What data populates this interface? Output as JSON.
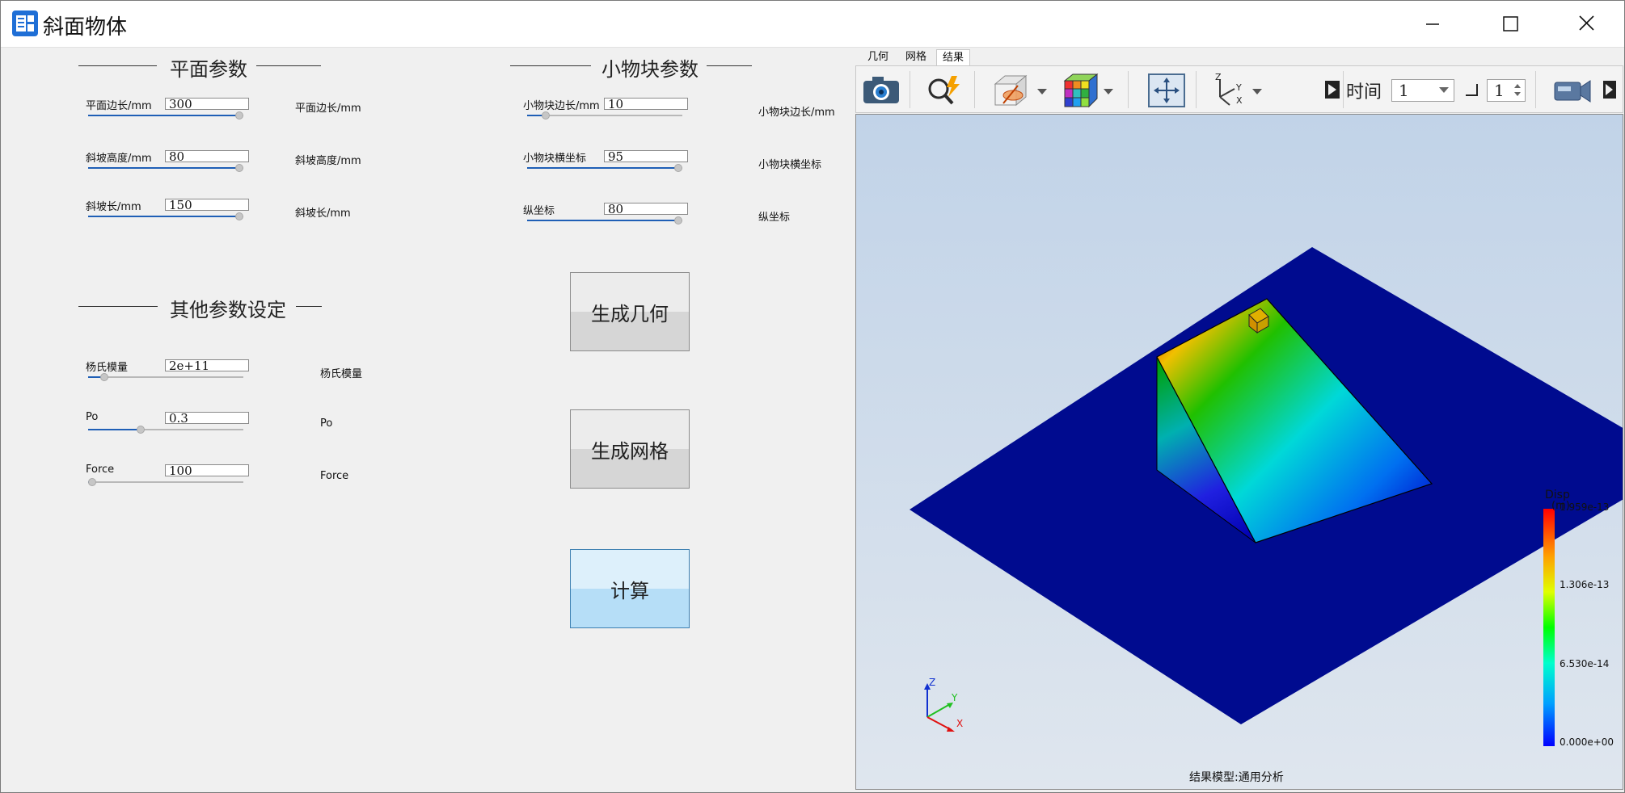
{
  "window": {
    "title": "斜面物体"
  },
  "plane_section": {
    "title": "平面参数",
    "params": [
      {
        "label": "平面边长/mm",
        "value": "300",
        "echo": "平面边长/mm",
        "fraction": 1.0
      },
      {
        "label": "斜坡高度/mm",
        "value": "80",
        "echo": "斜坡高度/mm",
        "fraction": 1.0
      },
      {
        "label": "斜坡长/mm",
        "value": "150",
        "echo": "斜坡长/mm",
        "fraction": 1.0
      }
    ]
  },
  "block_section": {
    "title": "小物块参数",
    "params": [
      {
        "label": "小物块边长/mm",
        "value": "10",
        "echo": "小物块边长/mm",
        "fraction": 0.1
      },
      {
        "label": "小物块横坐标",
        "value": "95",
        "echo": "小物块横坐标",
        "fraction": 1.0
      },
      {
        "label": "纵坐标",
        "value": "80",
        "echo": "纵坐标",
        "fraction": 1.0
      }
    ]
  },
  "other_section": {
    "title": "其他参数设定",
    "params": [
      {
        "label": "杨氏模量",
        "value": "2e+11",
        "echo": "杨氏模量",
        "fraction": 0.08
      },
      {
        "label": "Po",
        "value": "0.3",
        "echo": "Po",
        "fraction": 0.33
      },
      {
        "label": "Force",
        "value": "100",
        "echo": "Force",
        "fraction": 0.0
      }
    ]
  },
  "actions": {
    "generate_geometry": "生成几何",
    "generate_mesh": "生成网格",
    "compute": "计算"
  },
  "viewer": {
    "tabs": [
      "几何",
      "网格",
      "结果"
    ],
    "active_tab": "结果",
    "time_label": "时间",
    "time_value": "1",
    "step_value": "1",
    "legend": {
      "title": "Disp",
      "unit": "(m)",
      "ticks": [
        "1.959e-13",
        "1.306e-13",
        "6.530e-14",
        "0.000e+00"
      ]
    },
    "axis_labels": {
      "z": "Z",
      "y": "Y",
      "x": "X"
    },
    "status": "结果模型:通用分析",
    "icons": [
      "camera-icon",
      "query-icon",
      "section-view-icon",
      "dropdown-icon",
      "mesh-color-icon",
      "fit-view-icon",
      "axes-orientation-icon",
      "playback-icon",
      "video-camera-icon"
    ]
  },
  "colors": {
    "slider_fill": "#1f5fb6",
    "plane": "#000b8f",
    "accent_blue": "#b6def7"
  }
}
